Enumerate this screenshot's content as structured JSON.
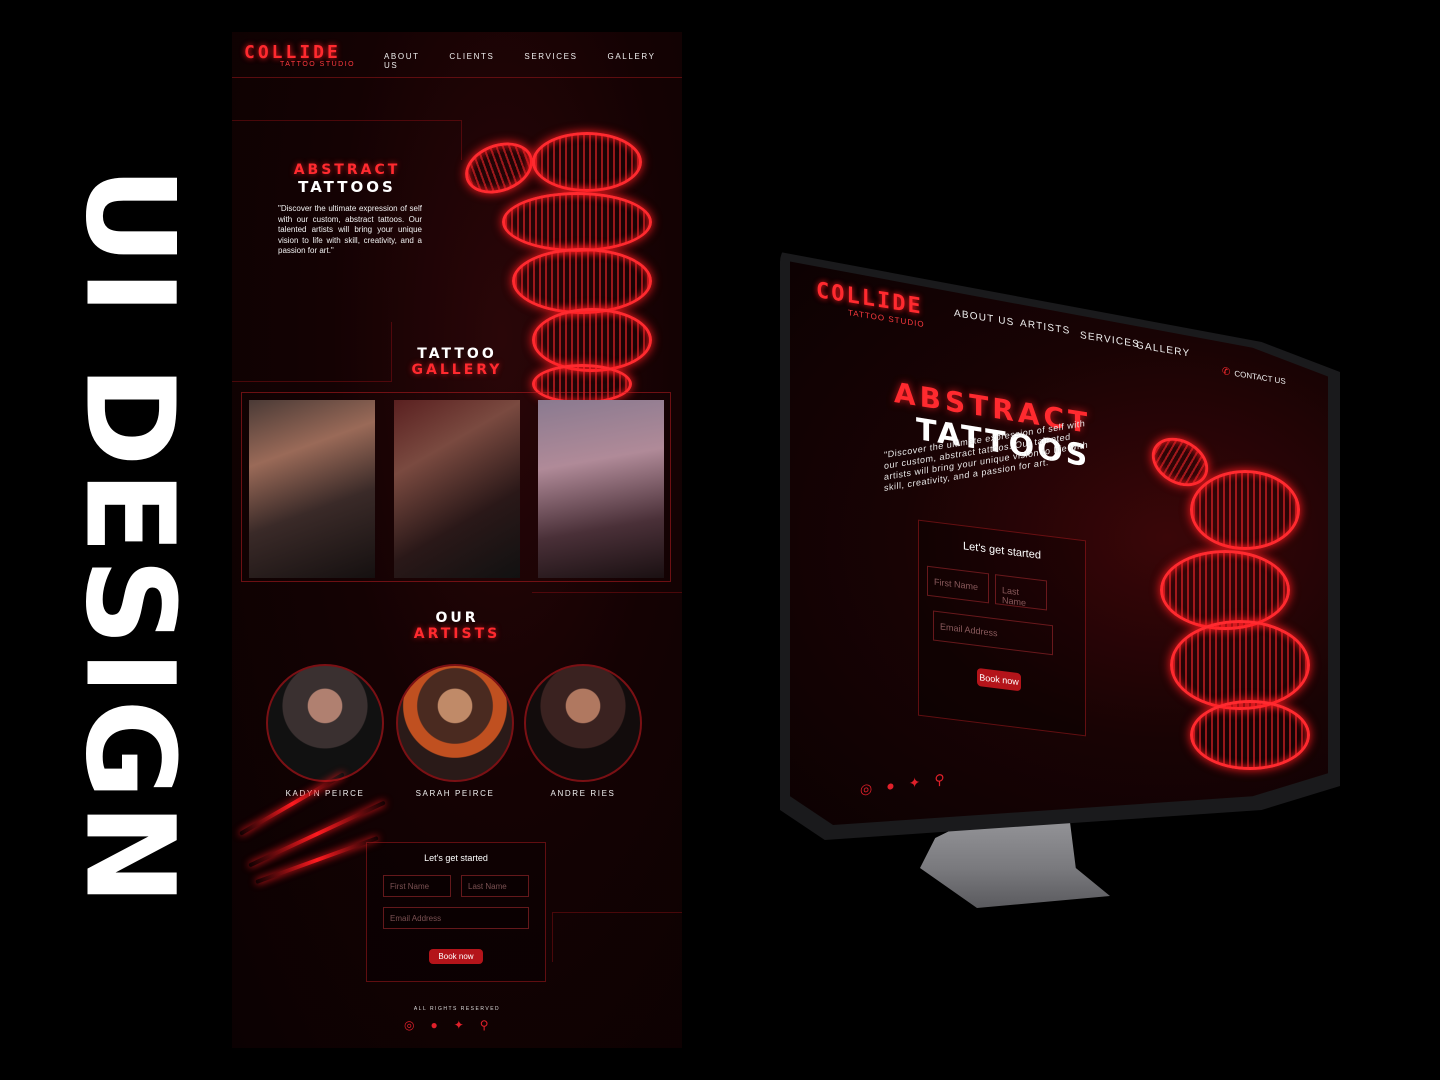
{
  "vertical_title": "UI DESIGN",
  "page": {
    "logo": {
      "main": "COLLIDE",
      "sub": "TATTOO STUDIO"
    },
    "nav": [
      "ABOUT US",
      "CLIENTS",
      "SERVICES",
      "GALLERY"
    ],
    "hero": {
      "title_red": "ABSTRACT",
      "title_white": "TATTOOS",
      "description": "\"Discover the ultimate expression of self with our custom, abstract tattoos. Our talented artists will bring your unique vision to life with skill, creativity, and a passion for art.\""
    },
    "gallery": {
      "title_white": "TATTOO",
      "title_red": "GALLERY"
    },
    "artists": {
      "title_white": "OUR",
      "title_red": "ARTISTS",
      "names": [
        "KADYN PEIRCE",
        "SARAH PEIRCE",
        "ANDRE RIES"
      ]
    },
    "form": {
      "title": "Let's get started",
      "first_name_placeholder": "First Name",
      "last_name_placeholder": "Last Name",
      "email_placeholder": "Email Address",
      "button": "Book now"
    },
    "footer": {
      "rights": "ALL RIGHTS RESERVED"
    }
  },
  "monitor": {
    "logo": {
      "main": "COLLIDE",
      "sub": "TATTOO STUDIO"
    },
    "nav": [
      "ABOUT US",
      "ARTISTS",
      "SERVICES",
      "GALLERY"
    ],
    "contact": "CONTACT US",
    "hero": {
      "title_red": "ABSTRACT",
      "title_white": "TATTOOS",
      "description": "\"Discover the ultimate expression of self with our custom, abstract tattoos. Our talented artists will bring your unique vision to life with skill, creativity, and a passion for art.\""
    },
    "form": {
      "title": "Let's get started",
      "first_name_placeholder": "First Name",
      "last_name_placeholder": "Last Name",
      "email_placeholder": "Email Address",
      "button": "Book now"
    }
  },
  "icons": [
    "instagram-icon",
    "facebook-icon",
    "twitter-icon",
    "location-pin-icon",
    "phone-icon"
  ],
  "colors": {
    "accent": "#ff2a2f",
    "button": "#b4141a",
    "background": "#000000"
  }
}
